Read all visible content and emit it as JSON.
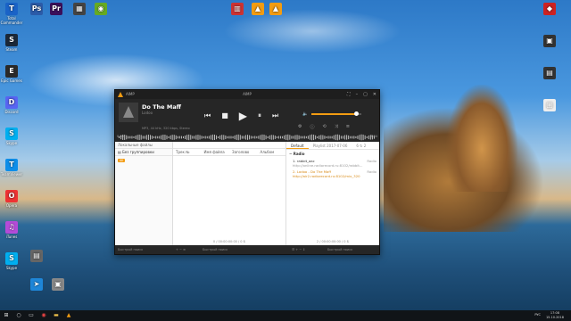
{
  "desktop": {
    "icons_left": [
      {
        "label": "Total Commander",
        "color": "#1a63c7",
        "glyph": "T"
      },
      {
        "label": "Steam",
        "color": "#1b2838",
        "glyph": "S"
      },
      {
        "label": "Epic Games",
        "color": "#2a2a2a",
        "glyph": "E"
      },
      {
        "label": "Discord",
        "color": "#5865f2",
        "glyph": "D"
      },
      {
        "label": "Skype",
        "color": "#00aff0",
        "glyph": "S"
      },
      {
        "label": "TeamViewer",
        "color": "#0e8ee9",
        "glyph": "T"
      },
      {
        "label": "Opera",
        "color": "#e33",
        "glyph": "O"
      },
      {
        "label": "iTunes",
        "color": "#b44bd8",
        "glyph": "♫"
      },
      {
        "label": "Skype",
        "color": "#00aff0",
        "glyph": "S"
      }
    ],
    "icons_left2": [
      {
        "label": "",
        "color": "#2b5ba8",
        "glyph": "Ps"
      },
      {
        "label": "",
        "color": "#3a0f5a",
        "glyph": "Pr"
      },
      {
        "label": "",
        "color": "#444",
        "glyph": "▦"
      },
      {
        "label": "",
        "color": "#6a2",
        "glyph": "◉"
      },
      {
        "label": "",
        "color": "#666",
        "glyph": "▤"
      },
      {
        "label": "",
        "color": "#1e86d8",
        "glyph": "➤"
      },
      {
        "label": "",
        "color": "#888",
        "glyph": "▣"
      }
    ],
    "icons_top": [
      {
        "label": "",
        "color": "#c33",
        "glyph": "▥"
      },
      {
        "label": "",
        "color": "#f39c12",
        "glyph": "▲"
      },
      {
        "label": "",
        "color": "#f39c12",
        "glyph": "▲"
      }
    ],
    "icons_right": [
      {
        "label": "",
        "color": "#c22",
        "glyph": "◆"
      },
      {
        "label": "",
        "color": "#333",
        "glyph": "▣"
      },
      {
        "label": "",
        "color": "#333",
        "glyph": "▤"
      },
      {
        "label": "",
        "color": "#eee",
        "glyph": "▢"
      }
    ]
  },
  "window": {
    "app_name": "AIMP",
    "center_title": "AIMP",
    "buttons": [
      "⛶",
      "–",
      "▢",
      "✕"
    ]
  },
  "player": {
    "title": "Do The Maff",
    "artist": "Lodoo",
    "info": "MP3, 44 kHz, 320 kbps, Stereo",
    "time_elapsed": "0:00",
    "time_total": "3:04",
    "volume": 0.88,
    "controls": {
      "prev": "⏮",
      "stop": "■",
      "play": "▶",
      "pause": "⏸",
      "next": "⏭"
    }
  },
  "library": {
    "tab": "Локальные файлы",
    "grouping": "Без группировки",
    "all_badge": "All",
    "columns": [
      "Трек №",
      "Имя файла",
      "Заголово",
      "Альбом"
    ],
    "status": "0 / 00:00:00:00 / 0 Б"
  },
  "playlist": {
    "tabs": [
      {
        "label": "Default",
        "active": true
      },
      {
        "label": "Playlist 2017-07-06",
        "active": false
      },
      {
        "label": "6 ↻ 2",
        "active": false
      }
    ],
    "group": "Radio",
    "items": [
      {
        "title": "1. rabbit_aac",
        "url": "http://online.radiorecord.ru:8102/rabbit...",
        "tag": "Radio",
        "playing": false
      },
      {
        "title": "2. Lodoo - Do The Maff",
        "url": "http://air2.radiorecord.ru:8102/mix_320",
        "tag": "Radio",
        "playing": true
      }
    ],
    "status": "2 / 00:00:00:00 / 0 Б"
  },
  "footer": {
    "search_left": "Быстрый поиск",
    "search_right": "Быстрый поиск"
  },
  "taskbar": {
    "lang": "РУС",
    "time": "17:08",
    "date": "15.10.2018"
  }
}
